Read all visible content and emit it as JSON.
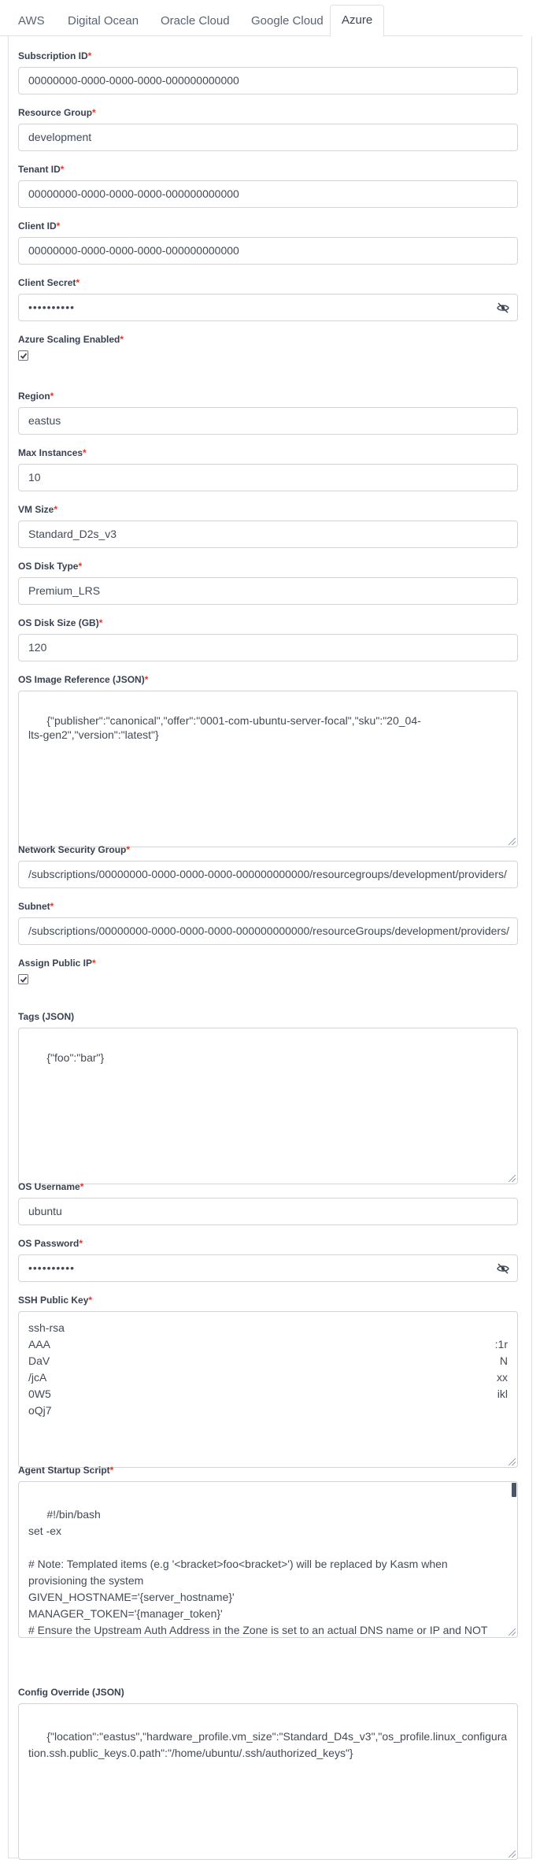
{
  "tabs": [
    "AWS",
    "Digital Ocean",
    "Oracle Cloud",
    "Google Cloud",
    "Azure"
  ],
  "active_tab": "Azure",
  "required_mark": "*",
  "fields": {
    "subscription_id": {
      "label": "Subscription ID",
      "value": "00000000-0000-0000-0000-000000000000"
    },
    "resource_group": {
      "label": "Resource Group",
      "value": "development"
    },
    "tenant_id": {
      "label": "Tenant ID",
      "value": "00000000-0000-0000-0000-000000000000"
    },
    "client_id": {
      "label": "Client ID",
      "value": "00000000-0000-0000-0000-000000000000"
    },
    "client_secret": {
      "label": "Client Secret",
      "value": "••••••••••"
    },
    "azure_scaling_enabled": {
      "label": "Azure Scaling Enabled",
      "checked": true
    },
    "region": {
      "label": "Region",
      "value": "eastus"
    },
    "max_instances": {
      "label": "Max Instances",
      "value": "10"
    },
    "vm_size": {
      "label": "VM Size",
      "value": "Standard_D2s_v3"
    },
    "os_disk_type": {
      "label": "OS Disk Type",
      "value": "Premium_LRS"
    },
    "os_disk_size": {
      "label": "OS Disk Size (GB)",
      "value": "120"
    },
    "os_image_reference": {
      "label": "OS Image Reference (JSON)",
      "value": "{\"publisher\":\"canonical\",\"offer\":\"0001-com-ubuntu-server-focal\",\"sku\":\"20_04-lts-gen2\",\"version\":\"latest\"}"
    },
    "network_security_group": {
      "label": "Network Security Group",
      "value": "/subscriptions/00000000-0000-0000-0000-000000000000/resourcegroups/development/providers/"
    },
    "subnet": {
      "label": "Subnet",
      "value": "/subscriptions/00000000-0000-0000-0000-000000000000/resourceGroups/development/providers/"
    },
    "assign_public_ip": {
      "label": "Assign Public IP",
      "checked": true
    },
    "tags": {
      "label": "Tags (JSON)",
      "value": "{\"foo\":\"bar\"}"
    },
    "os_username": {
      "label": "OS Username",
      "value": "ubuntu"
    },
    "os_password": {
      "label": "OS Password",
      "value": "••••••••••"
    },
    "ssh_public_key": {
      "label": "SSH Public Key",
      "lines": [
        {
          "start": "ssh-rsa",
          "end": ""
        },
        {
          "start": "AAA",
          "end": ":1r"
        },
        {
          "start": "DaV",
          "end": "N"
        },
        {
          "start": "/jcA",
          "end": "xx"
        },
        {
          "start": "0W5",
          "end": "ikl"
        },
        {
          "start": "oQj7",
          "end": ""
        }
      ]
    },
    "agent_startup_script": {
      "label": "Agent Startup Script",
      "value": "#!/bin/bash\nset -ex\n\n# Note: Templated items (e.g '<bracket>foo<bracket>') will be replaced by Kasm when provisioning the system\nGIVEN_HOSTNAME='{server_hostname}'\nMANAGER_TOKEN='{manager_token}'\n# Ensure the Upstream Auth Address in the Zone is set to an actual DNS name or IP and NOT $request_host$"
    },
    "config_override": {
      "label": "Config Override (JSON)",
      "value": "{\"location\":\"eastus\",\"hardware_profile.vm_size\":\"Standard_D4s_v3\",\"os_profile.linux_configuration.ssh.public_keys.0.path\":\"/home/ubuntu/.ssh/authorized_keys\"}"
    }
  },
  "icons": {
    "password_toggle": "eye-slash-icon",
    "checkbox_check": "check-icon"
  }
}
